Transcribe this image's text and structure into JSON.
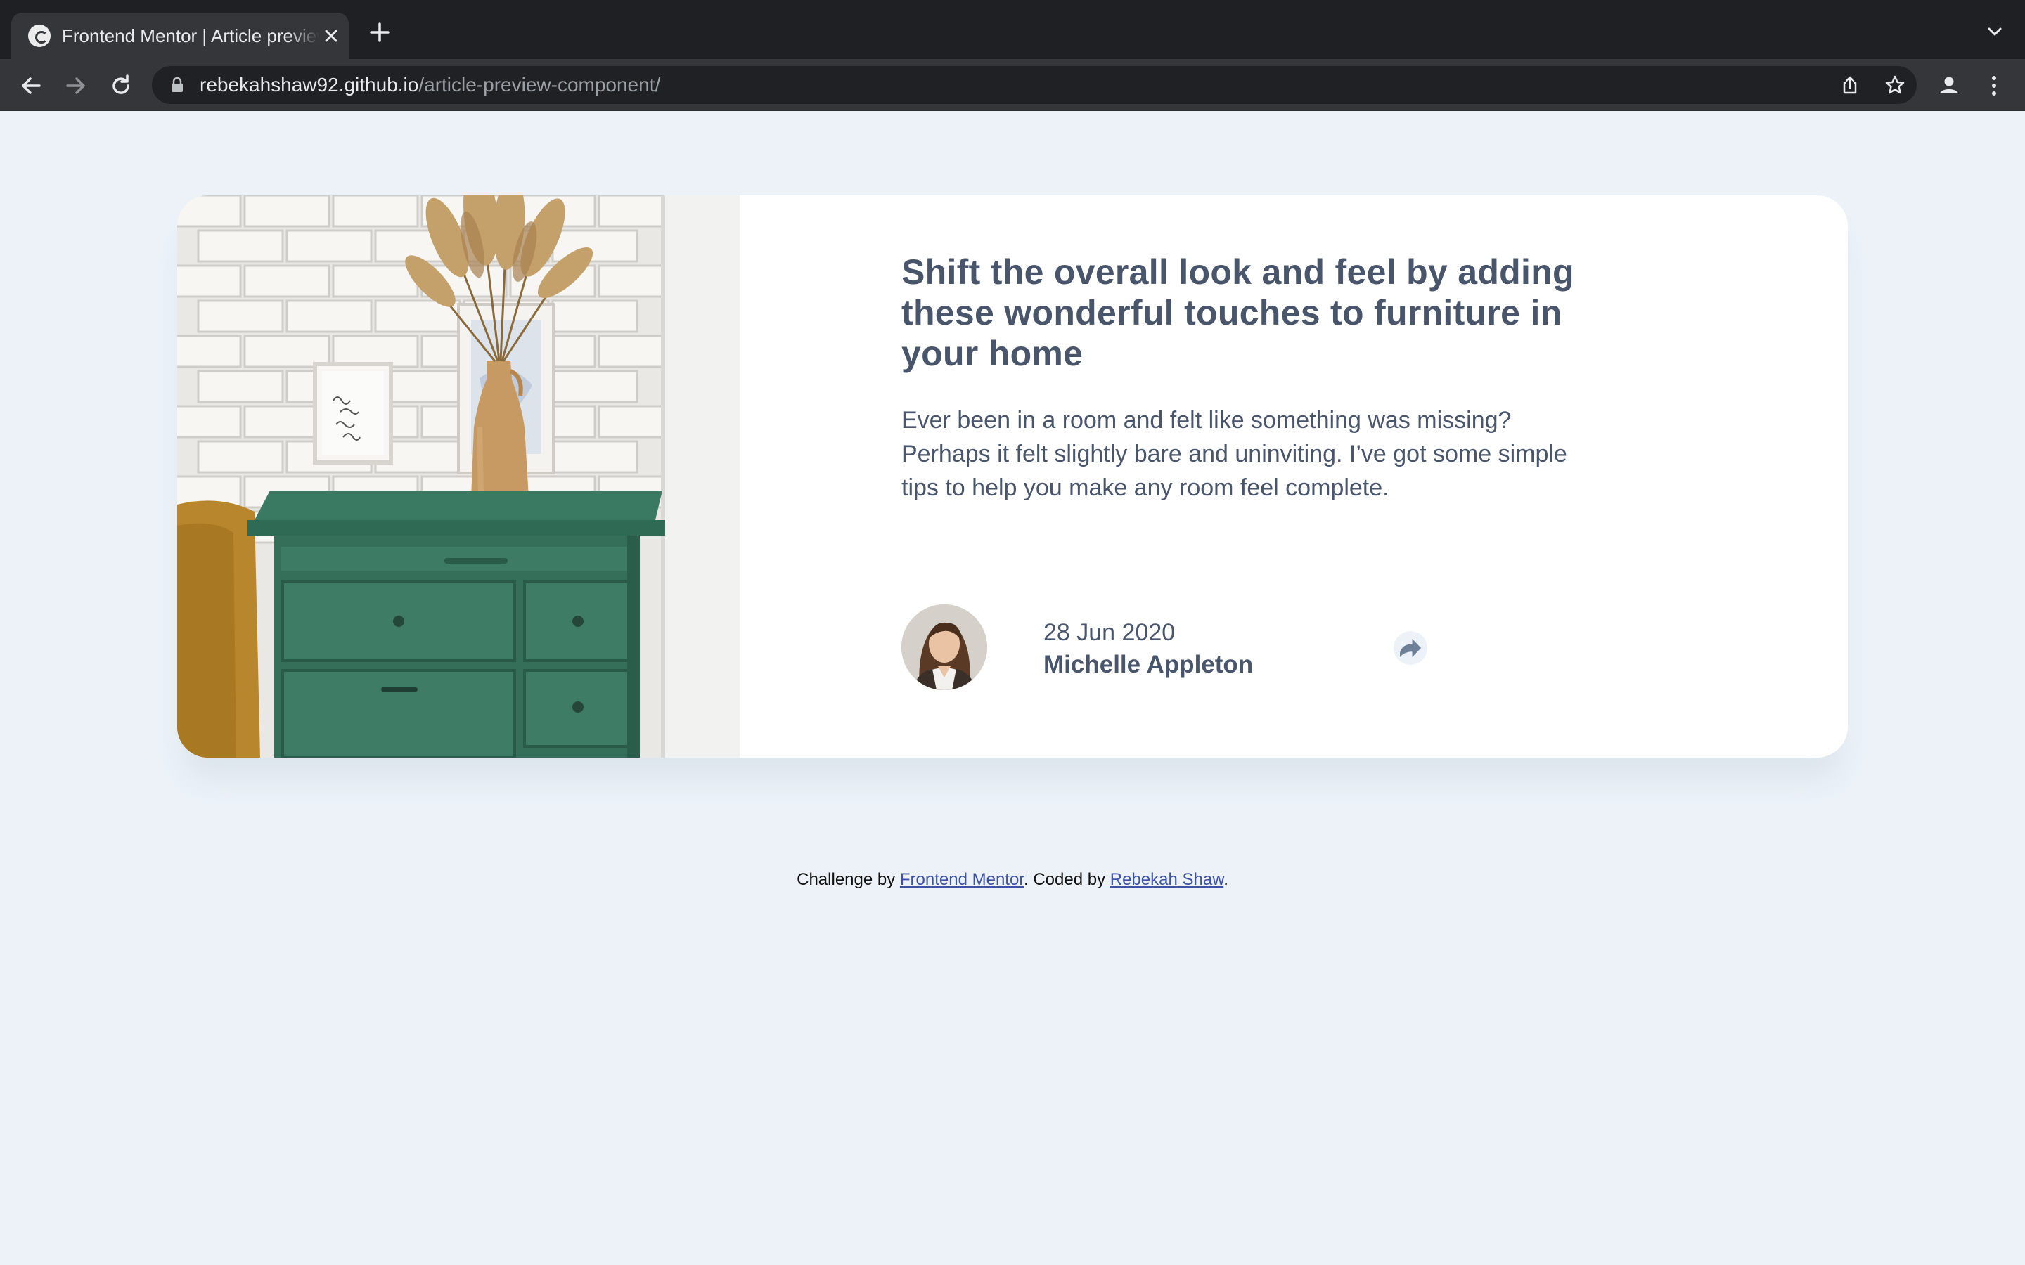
{
  "browser": {
    "tab": {
      "title": "Frontend Mentor | Article preview component",
      "favicon": "frontend-mentor-icon"
    },
    "url": {
      "host": "rebekahshaw92.github.io",
      "path": "/article-preview-component/"
    },
    "icons": [
      "back-arrow-icon",
      "forward-arrow-icon",
      "reload-icon",
      "lock-icon",
      "share-page-icon",
      "bookmark-star-icon",
      "profile-icon",
      "kebab-menu-icon",
      "tab-search-chevron-icon",
      "new-tab-plus-icon",
      "close-tab-icon"
    ]
  },
  "article": {
    "image_alt": "drawers",
    "title": "Shift the overall look and feel by adding these wonderful touches to furniture in your home",
    "description": "Ever been in a room and felt like something was missing? Perhaps it felt slightly bare and uninviting. I’ve got some simple tips to help you make any room feel complete.",
    "date": "28 Jun 2020",
    "author": "Michelle Appleton",
    "share_icon": "share-icon"
  },
  "attribution": {
    "prefix": "Challenge by ",
    "link1": "Frontend Mentor",
    "middle": ". Coded by ",
    "link2": "Rebekah Shaw",
    "suffix": "."
  },
  "colors": {
    "page_bg": "#ecf2f8",
    "card_bg": "#ffffff",
    "text_dark": "#48556a",
    "link": "#3e52a3",
    "chrome_dark": "#1f2023",
    "chrome_toolbar": "#35363a",
    "share_icon": "#6e8098"
  }
}
